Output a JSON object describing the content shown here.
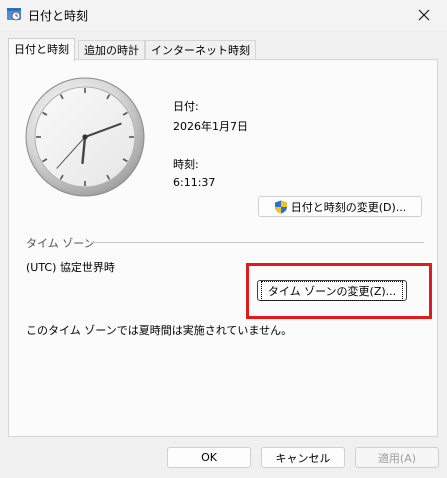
{
  "window": {
    "title": "日付と時刻"
  },
  "tabs": [
    {
      "label": "日付と時刻",
      "active": true
    },
    {
      "label": "追加の時計",
      "active": false
    },
    {
      "label": "インターネット時刻",
      "active": false
    }
  ],
  "datetime": {
    "date_label": "日付:",
    "date_value": "2026年1月7日",
    "time_label": "時刻:",
    "time_value": "6:11:37",
    "change_button": "日付と時刻の変更(D)..."
  },
  "timezone": {
    "section_label": "タイム ゾーン",
    "current": "(UTC) 協定世界時",
    "change_button": "タイム ゾーンの変更(Z)...",
    "dst_note": "このタイム ゾーンでは夏時間は実施されていません。"
  },
  "footer": {
    "ok": "OK",
    "cancel": "キャンセル",
    "apply": "適用(A)"
  },
  "colors": {
    "highlight": "#e01b1b"
  }
}
